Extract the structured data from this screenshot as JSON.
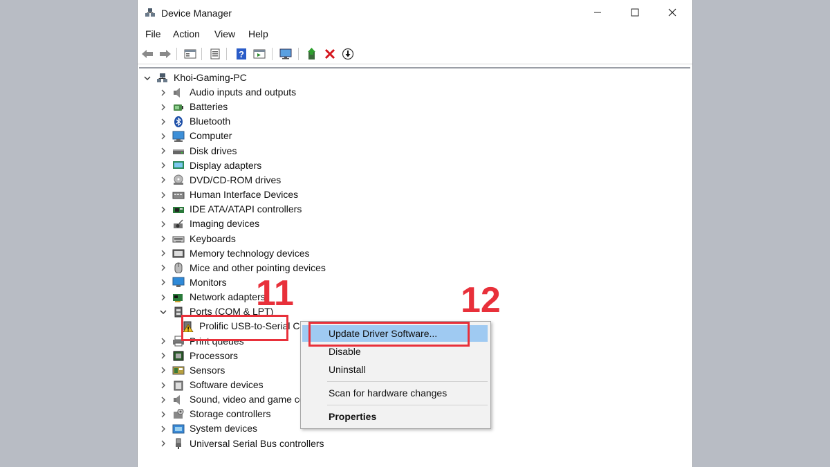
{
  "window": {
    "title": "Device Manager"
  },
  "menu": [
    "File",
    "Action",
    "View",
    "Help"
  ],
  "tree": {
    "root": "Khoi-Gaming-PC",
    "items": [
      {
        "label": "Audio inputs and outputs",
        "icon": "speaker-icon"
      },
      {
        "label": "Batteries",
        "icon": "battery-icon"
      },
      {
        "label": "Bluetooth",
        "icon": "bluetooth-icon"
      },
      {
        "label": "Computer",
        "icon": "computer-icon"
      },
      {
        "label": "Disk drives",
        "icon": "disk-drive-icon"
      },
      {
        "label": "Display adapters",
        "icon": "display-adapter-icon"
      },
      {
        "label": "DVD/CD-ROM drives",
        "icon": "dvd-icon"
      },
      {
        "label": "Human Interface Devices",
        "icon": "hid-icon"
      },
      {
        "label": "IDE ATA/ATAPI controllers",
        "icon": "ide-controller-icon"
      },
      {
        "label": "Imaging devices",
        "icon": "camera-icon"
      },
      {
        "label": "Keyboards",
        "icon": "keyboard-icon"
      },
      {
        "label": "Memory technology devices",
        "icon": "memory-icon"
      },
      {
        "label": "Mice and other pointing devices",
        "icon": "mouse-icon"
      },
      {
        "label": "Monitors",
        "icon": "monitor-icon"
      },
      {
        "label": "Network adapters",
        "icon": "network-icon"
      },
      {
        "label": "Ports (COM & LPT)",
        "icon": "port-icon",
        "expanded": true
      },
      {
        "label": "Prolific USB-to-Serial C",
        "icon": "warning-device-icon",
        "child": true
      },
      {
        "label": "Print queues",
        "icon": "printer-icon"
      },
      {
        "label": "Processors",
        "icon": "processor-icon"
      },
      {
        "label": "Sensors",
        "icon": "sensor-icon"
      },
      {
        "label": "Software devices",
        "icon": "software-device-icon"
      },
      {
        "label": "Sound, video and game co",
        "icon": "speaker-icon"
      },
      {
        "label": "Storage controllers",
        "icon": "storage-icon"
      },
      {
        "label": "System devices",
        "icon": "system-icon"
      },
      {
        "label": "Universal Serial Bus controllers",
        "icon": "usb-icon"
      }
    ]
  },
  "context_menu": {
    "update": "Update Driver Software...",
    "disable": "Disable",
    "uninstall": "Uninstall",
    "scan": "Scan for hardware changes",
    "properties": "Properties"
  },
  "annotations": {
    "step1": "11",
    "step2": "12"
  },
  "colors": {
    "highlight": "#9fcaf2",
    "annotation": "#e8303a"
  }
}
